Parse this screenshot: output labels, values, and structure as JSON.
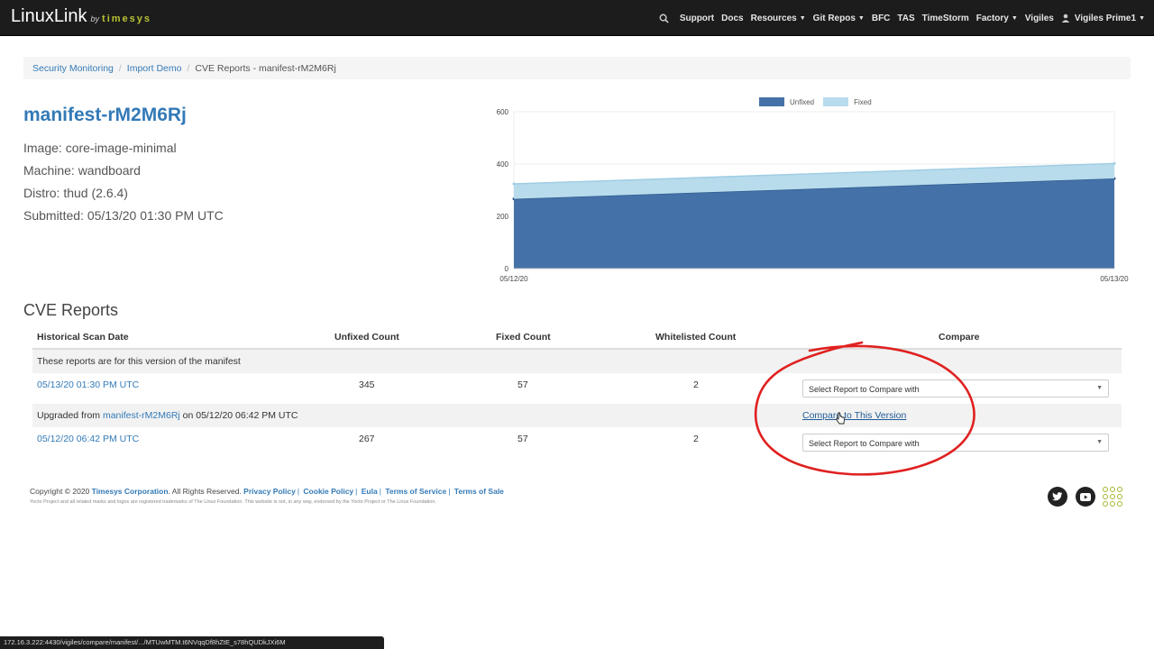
{
  "brand": {
    "name": "LinuxLink",
    "by": "by",
    "company": "timesys"
  },
  "nav": {
    "items": [
      {
        "label": "Support",
        "caret": false
      },
      {
        "label": "Docs",
        "caret": false
      },
      {
        "label": "Resources",
        "caret": true
      },
      {
        "label": "Git Repos",
        "caret": true
      },
      {
        "label": "BFC",
        "caret": false
      },
      {
        "label": "TAS",
        "caret": false
      },
      {
        "label": "TimeStorm",
        "caret": false
      },
      {
        "label": "Factory",
        "caret": true
      },
      {
        "label": "Vigiles",
        "caret": false
      }
    ],
    "user": "Vigiles Prime1"
  },
  "breadcrumb": {
    "items": [
      "Security Monitoring",
      "Import Demo"
    ],
    "active": "CVE Reports - manifest-rM2M6Rj",
    "separator": "/"
  },
  "manifest": {
    "title": "manifest-rM2M6Rj",
    "image": "Image: core-image-minimal",
    "machine": "Machine: wandboard",
    "distro": "Distro: thud (2.6.4)",
    "submitted": "Submitted: 05/13/20 01:30 PM UTC"
  },
  "chart_data": {
    "type": "area",
    "x": [
      "05/12/20",
      "05/13/20"
    ],
    "series": [
      {
        "name": "Unfixed",
        "values": [
          267,
          345
        ],
        "color": "#4472a8"
      },
      {
        "name": "Fixed",
        "values": [
          57,
          57
        ],
        "color": "#b8dcec"
      }
    ],
    "stacked": true,
    "ylim": [
      0,
      600
    ],
    "yticks": [
      "0",
      "200",
      "400",
      "600"
    ],
    "legend": "top",
    "grid": true
  },
  "cve": {
    "title": "CVE Reports",
    "headers": {
      "date": "Historical Scan Date",
      "unfixed": "Unfixed Count",
      "fixed": "Fixed Count",
      "whitelisted": "Whitelisted Count",
      "compare": "Compare"
    },
    "version_note": "These reports are for this version of the manifest",
    "rows": [
      {
        "date": "05/13/20 01:30 PM UTC",
        "unfixed": "345",
        "fixed": "57",
        "whitelisted": "2",
        "select": "Select Report to Compare with"
      },
      {
        "date": "05/12/20 06:42 PM UTC",
        "unfixed": "267",
        "fixed": "57",
        "whitelisted": "2",
        "select": "Select Report to Compare with"
      }
    ],
    "upgrade": {
      "prefix": "Upgraded from",
      "link": "manifest-rM2M6Rj",
      "suffix": "on 05/12/20 06:42 PM UTC",
      "compare_link": "Compare to This Version"
    }
  },
  "footer": {
    "copyright": "Copyright © 2020",
    "company": "Timesys Corporation",
    "rights": ". All Rights Reserved.",
    "links": [
      "Privacy Policy",
      "Cookie Policy",
      "Eula",
      "Terms of Service",
      "Terms of Sale"
    ],
    "disclaimer": "Yocto Project and all related marks and logos are registered trademarks of The Linux Foundation. This website is not, in any way, endorsed by the Yocto Project or The Linux Foundation."
  },
  "social": [
    "twitter-icon",
    "youtube-icon",
    "timesys-grid-icon"
  ],
  "status_url": "172.16.3.222:4430/vigiles/compare/manifest/.../MTUwMTM.t6NVqqDf8hZtE_s78hQUDkJXi6M",
  "colors": {
    "link": "#337ab7",
    "annotation": "#e02020",
    "navbar": "#1c1c1c"
  }
}
